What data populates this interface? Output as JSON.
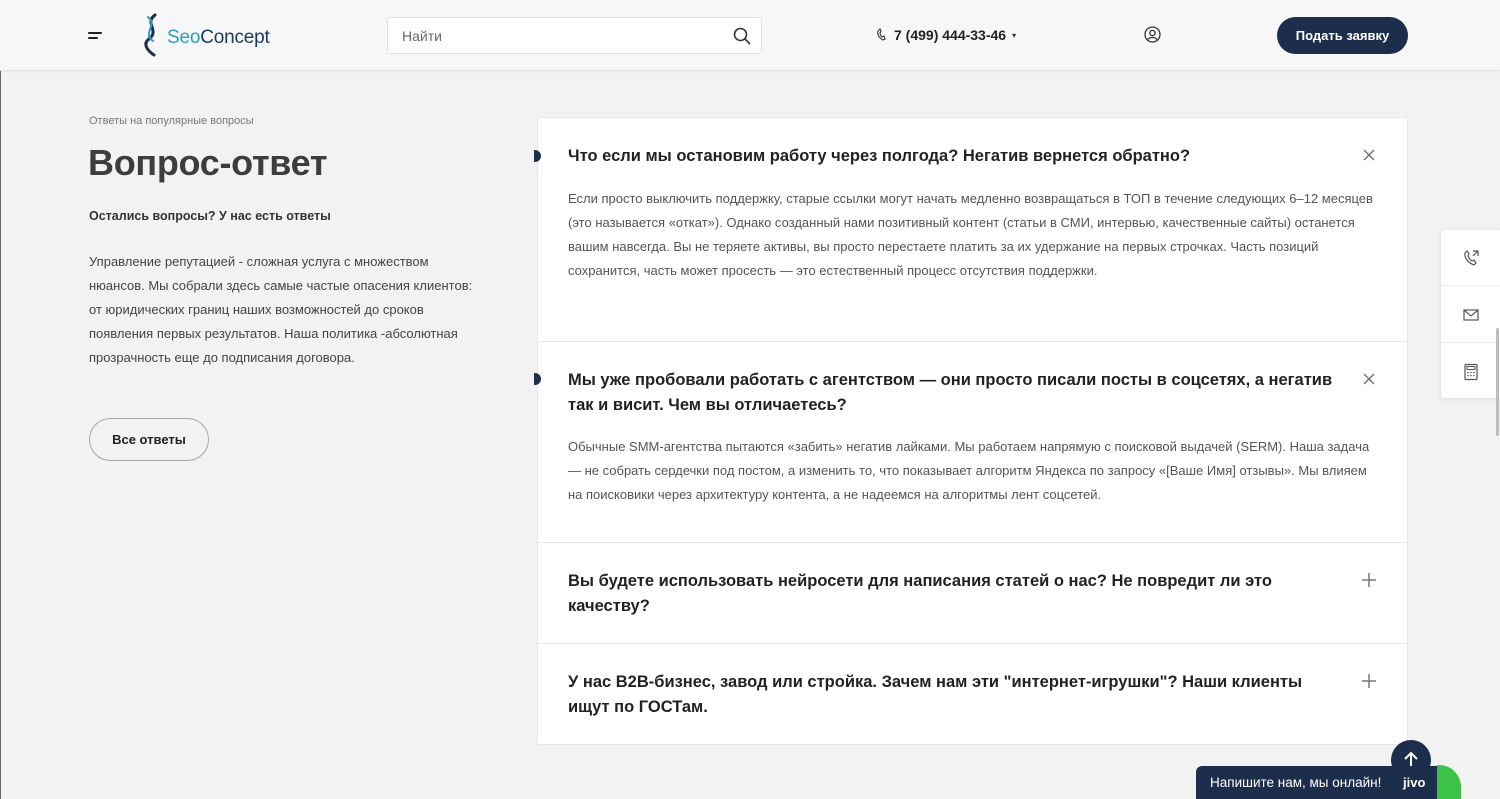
{
  "header": {
    "logo_part1": "Seo",
    "logo_part2": "Concept",
    "search_placeholder": "Найти",
    "phone": "7 (499) 444-33-46",
    "phone_caret": "▾",
    "cta_label": "Подать заявку"
  },
  "intro": {
    "breadcrumb": "Ответы на популярные вопросы",
    "title": "Вопрос-ответ",
    "subtitle": "Остались вопросы? У нас есть ответы",
    "description": "Управление репутацией - сложная услуга с множеством нюансов. Мы собрали здесь самые частые опасения клиентов: от юридических границ наших возможностей до сроков появления первых результатов. Наша политика -абсолютная прозрачность еще до подписания договора.",
    "all_answers_label": "Все ответы"
  },
  "faq": [
    {
      "question": "Что если мы остановим работу через полгода? Негатив вернется обратно?",
      "answer": "Если просто выключить поддержку, старые ссылки могут начать медленно возвращаться в ТОП в течение следующих 6–12 месяцев (это называется «откат»). Однако созданный нами позитивный контент (статьи в СМИ, интервью, качественные сайты) останется вашим навсегда. Вы не теряете активы, вы просто перестаете платить за их удержание на первых строчках. Часть позиций сохранится, часть может просесть — это естественный процесс отсутствия поддержки.",
      "expanded": true
    },
    {
      "question": "Мы уже пробовали работать с агентством — они просто писали посты в соцсетях, а негатив так и висит. Чем вы отличаетесь?",
      "answer": "Обычные SMM-агентства пытаются «забить» негатив лайками. Мы работаем напрямую с поисковой выдачей (SERM). Наша задача — не собрать сердечки под постом, а изменить то, что показывает алгоритм Яндекса по запросу «[Ваше Имя] отзывы». Мы влияем на поисковики через архитектуру контента, а не надеемся на алгоритмы лент соцсетей.",
      "expanded": true
    },
    {
      "question": "Вы будете использовать нейросети для написания статей о нас? Не повредит ли это качеству?",
      "answer": "",
      "expanded": false
    },
    {
      "question": "У нас B2B-бизнес, завод или стройка. Зачем нам эти \"интернет-игрушки\"? Наши клиенты ищут по ГОСТам.",
      "answer": "",
      "expanded": false
    }
  ],
  "chat": {
    "label": "Напишите нам, мы онлайн!",
    "brand": "jivo"
  },
  "colors": {
    "accent": "#1d2e4c",
    "logo_teal": "#2a9fb8",
    "chat_green": "#3cc247"
  }
}
